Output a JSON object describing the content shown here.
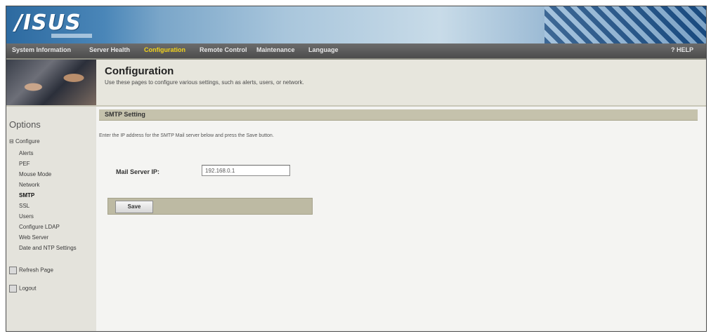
{
  "brand": {
    "logo_text": "/ISUS"
  },
  "nav": {
    "items": [
      "System Information",
      "Server Health",
      "Configuration",
      "Remote Control",
      "Maintenance",
      "Language"
    ],
    "active": "Configuration",
    "help_label": "? HELP"
  },
  "header": {
    "title": "Configuration",
    "description": "Use these pages to configure various settings, such as alerts, users, or network."
  },
  "sidebar": {
    "options_title": "Options",
    "section_label": "Configure",
    "items": [
      "Alerts",
      "PEF",
      "Mouse Mode",
      "Network",
      "SMTP",
      "SSL",
      "Users",
      "Configure LDAP",
      "Web Server",
      "Date and NTP Settings"
    ],
    "current_item": "SMTP",
    "refresh_label": "Refresh Page",
    "logout_label": "Logout"
  },
  "main": {
    "section_title": "SMTP Setting",
    "instructions": "Enter the IP address for the SMTP Mail server below and press the Save button.",
    "mail_server_label": "Mail Server IP:",
    "mail_server_value": "192.168.0.1",
    "save_label": "Save"
  }
}
